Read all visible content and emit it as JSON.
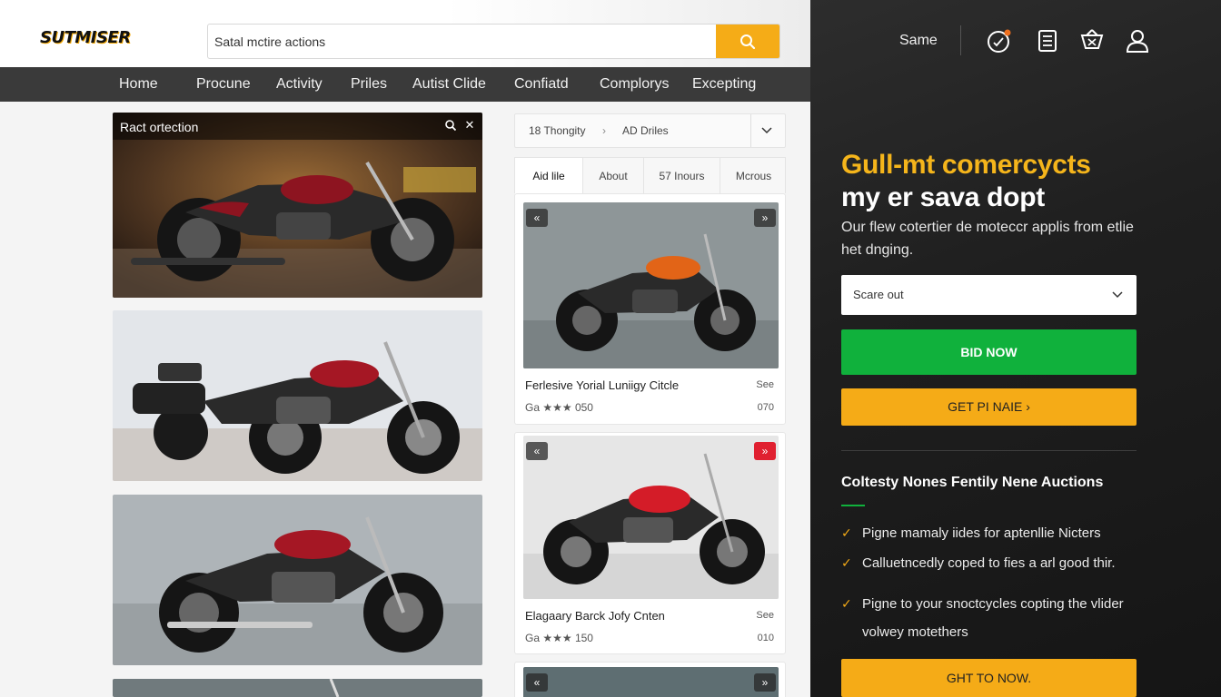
{
  "header": {
    "logo": "SUTMISER",
    "search_placeholder": "Satal mctire actions",
    "search_value": "Satal mctire actions"
  },
  "nav": {
    "items": [
      "Home",
      "Procune",
      "Activity",
      "Priles",
      "Autist Clide",
      "Confiatd",
      "Complorys",
      "Excepting"
    ]
  },
  "gallery": {
    "first_title": "Ract ortection"
  },
  "listing": {
    "breadcrumb": [
      "18 Thongity",
      "AD Driles"
    ],
    "tabs": [
      "Aid lile",
      "About",
      "57 Inours",
      "Mcrous"
    ],
    "cards": [
      {
        "title": "Ferlesive Yorial Luniigy Citcle",
        "meta": "Ga ★★★ 050",
        "right_top": "See",
        "right_bottom": "070"
      },
      {
        "title": "Elagaary Barck Jofy Cnten",
        "meta": "Ga ★★★ 150",
        "right_top": "See",
        "right_bottom": "010"
      }
    ]
  },
  "right_panel": {
    "user_name": "Same",
    "hero_line1": "Gull-mt comercycts",
    "hero_line2": "my er sava dopt",
    "hero_desc": "Our flew cotertier de moteccr applis from etlie het dnging.",
    "select_value": "Scare out",
    "bid_button": "BID NOW",
    "get_button": "GET PI NAIE ›",
    "section_title": "Coltesty Nones Fentily Nene Auctions",
    "bullets": [
      "Pigne mamaly iides for aptenllie Nicters",
      "Calluetncedly coped to fies a arl good thir.",
      "Pigne to your snoctcycles copting the vlider volwey motethers"
    ],
    "bottom_button": "GHT TO NOW."
  },
  "colors": {
    "accent_yellow": "#f5ab17",
    "accent_green": "#10b13c",
    "nav_bg": "#3a3a3a",
    "panel_bg": "#1f1f1f"
  }
}
